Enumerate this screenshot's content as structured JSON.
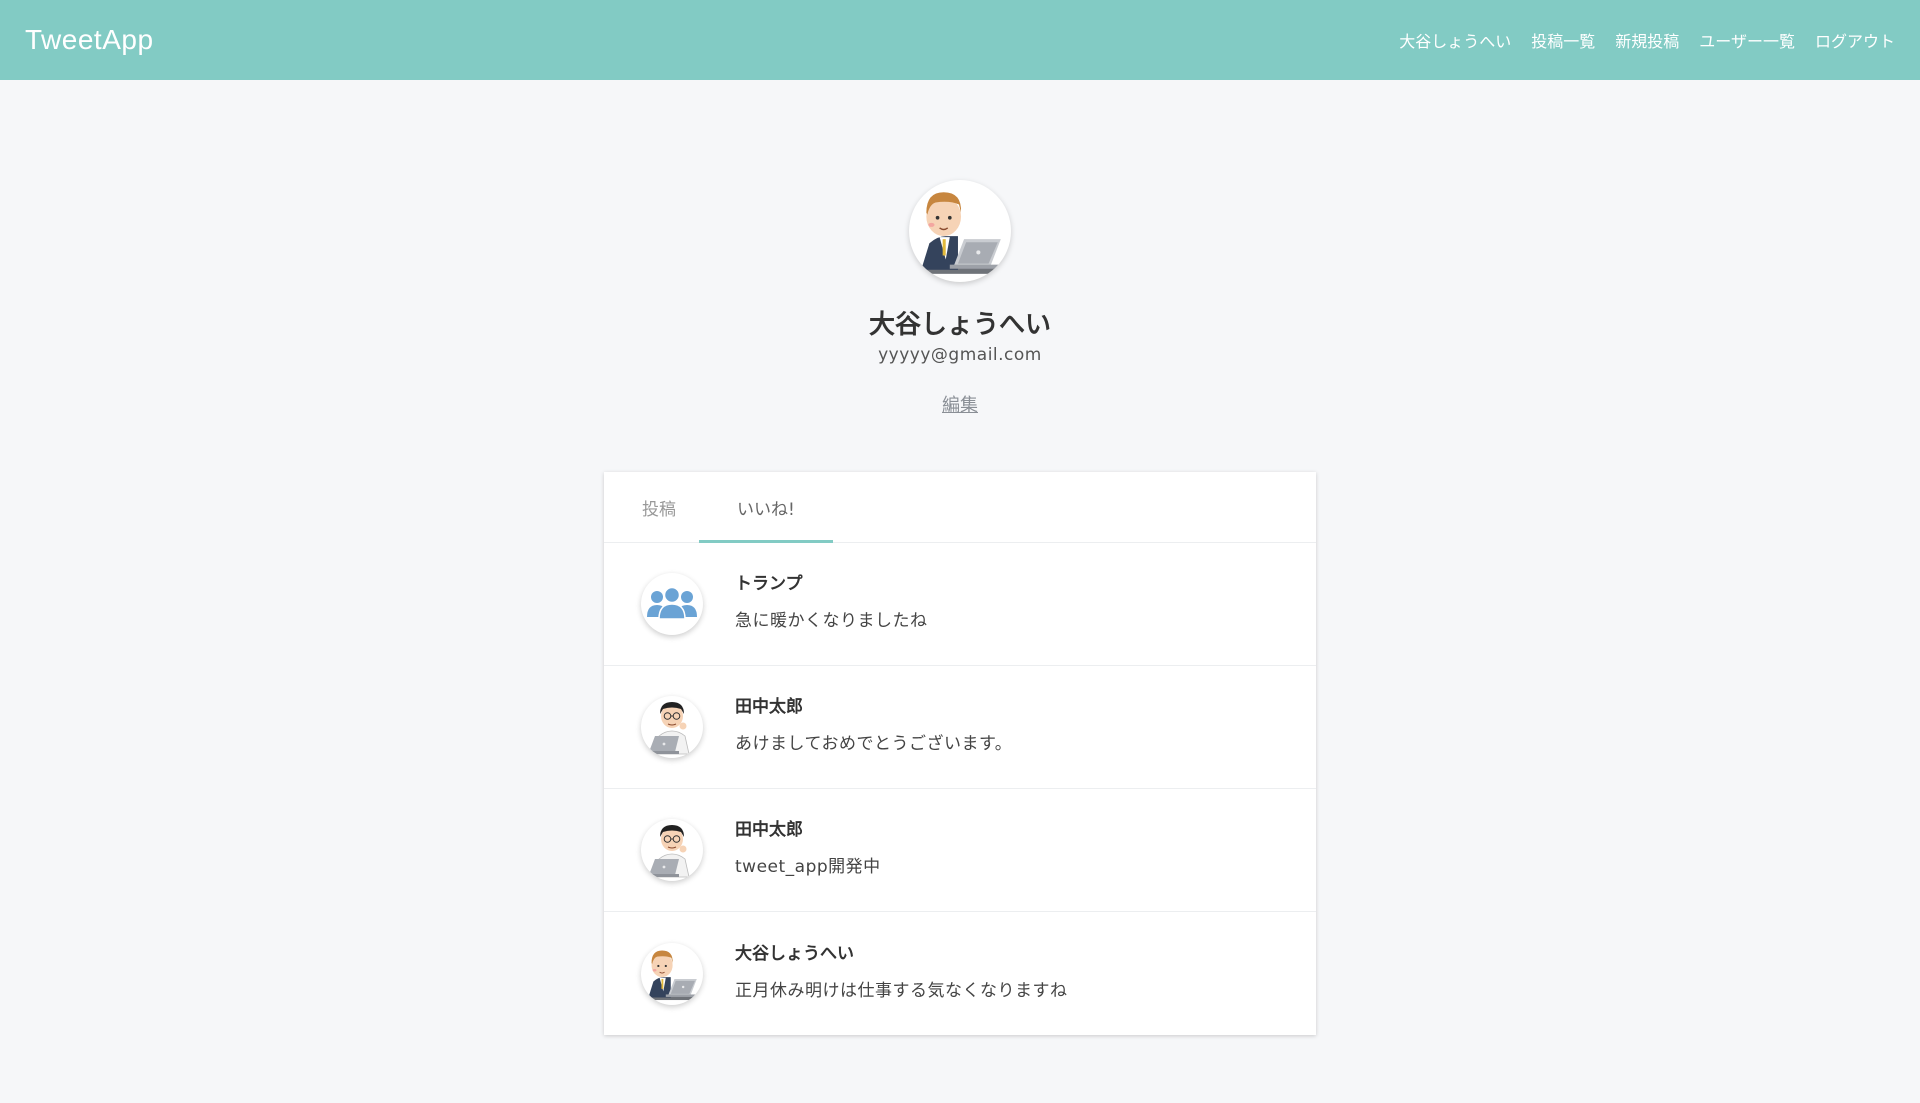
{
  "app": {
    "title": "TweetApp"
  },
  "nav": {
    "items": [
      {
        "label": "大谷しょうへい"
      },
      {
        "label": "投稿一覧"
      },
      {
        "label": "新規投稿"
      },
      {
        "label": "ユーザー一覧"
      },
      {
        "label": "ログアウト"
      }
    ]
  },
  "profile": {
    "name": "大谷しょうへい",
    "email": "yyyyy@gmail.com",
    "edit_label": "編集",
    "avatar_icon": "businessman-laptop-icon"
  },
  "tabs": [
    {
      "label": "投稿",
      "active": false
    },
    {
      "label": "いいね!",
      "active": true
    }
  ],
  "posts": [
    {
      "author": "トランプ",
      "text": "急に暖かくなりましたね",
      "avatar_icon": "users-group-icon"
    },
    {
      "author": "田中太郎",
      "text": "あけましておめでとうございます。",
      "avatar_icon": "man-glasses-laptop-icon"
    },
    {
      "author": "田中太郎",
      "text": "tweet_app開発中",
      "avatar_icon": "man-glasses-laptop-icon"
    },
    {
      "author": "大谷しょうへい",
      "text": "正月休み明けは仕事する気なくなりますね",
      "avatar_icon": "businessman-laptop-icon"
    }
  ],
  "colors": {
    "header": "#82cbc4",
    "accent": "#82cbc4",
    "background": "#f6f7f9"
  }
}
